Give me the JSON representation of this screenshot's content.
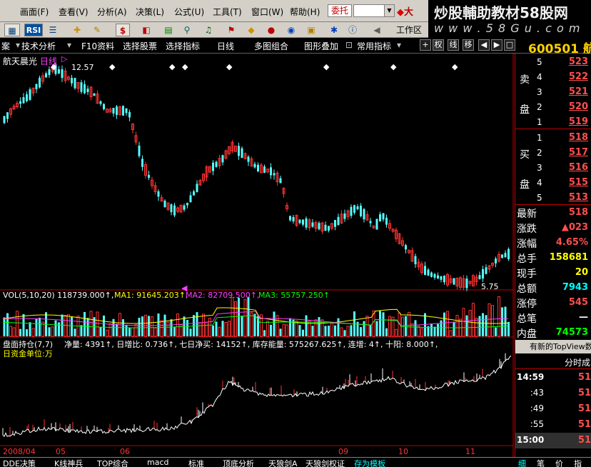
{
  "menu": {
    "items": [
      "画面(F)",
      "查看(V)",
      "分析(A)",
      "决策(L)",
      "公式(U)",
      "工具(T)",
      "窗口(W)",
      "帮助(H)"
    ],
    "weituo": "委托",
    "brand_short": "大"
  },
  "toolbar": {
    "rsi": "RSI",
    "workspace": "工作区"
  },
  "banner": {
    "title": "炒股輔助教材58股网",
    "url": "w w w . 5 8 G u . c o m"
  },
  "nav": {
    "items": [
      "案",
      "技术分析",
      "F10资料",
      "选择股票",
      "选择指标",
      "日线",
      "多图组合",
      "图形叠加",
      "常用指标"
    ],
    "buttons": [
      "权",
      "线",
      "移"
    ],
    "code": "600501 航"
  },
  "chart": {
    "stock_title": "航天晨光",
    "period": "日线",
    "high_label": "12.57",
    "low_label": "5.75",
    "vol_line": {
      "vol": "VOL(5,10,20) 118739.000↑,",
      "ma1": "MA1: 91645.203↑,",
      "ma2": "MA2: 82709.500↑,",
      "ma3": "MA3: 55757.250↑"
    },
    "pos_line": {
      "name": "盘面持仓(7,7)",
      "text": "净量: 4391↑, 日增比: 0.736↑, 七日净买: 14152↑, 库存能量: 575267.625↑, 连增: 4↑, 十阳: 8.000↑,"
    },
    "unit_line": "日资金单位:万",
    "x_labels": {
      "first": "2008/04",
      "m05": "05",
      "m06": "06",
      "m09": "09",
      "m10": "10",
      "m11": "11"
    }
  },
  "orderbook": {
    "sell_label": [
      "卖",
      "盘"
    ],
    "buy_label": [
      "买",
      "盘"
    ],
    "sell": [
      {
        "n": "5",
        "p": "523"
      },
      {
        "n": "4",
        "p": "522"
      },
      {
        "n": "3",
        "p": "521"
      },
      {
        "n": "2",
        "p": "520"
      },
      {
        "n": "1",
        "p": "519"
      }
    ],
    "buy": [
      {
        "n": "1",
        "p": "518"
      },
      {
        "n": "2",
        "p": "517"
      },
      {
        "n": "3",
        "p": "516"
      },
      {
        "n": "4",
        "p": "515"
      },
      {
        "n": "5",
        "p": "513"
      }
    ]
  },
  "stats": [
    {
      "label": "最新",
      "value": "518",
      "color": "#ff5050"
    },
    {
      "label": "涨跌",
      "value": "▲023",
      "color": "#ff5050"
    },
    {
      "label": "涨幅",
      "value": "4.65%",
      "color": "#ff5050"
    },
    {
      "label": "总手",
      "value": "158681",
      "color": "#ffff00"
    },
    {
      "label": "现手",
      "value": "20",
      "color": "#ffff00"
    },
    {
      "label": "总额",
      "value": "7943",
      "color": "#00ffff"
    },
    {
      "label": "涨停",
      "value": "545",
      "color": "#ff5050"
    },
    {
      "label": "总笔",
      "value": "—",
      "color": "#ffffff"
    },
    {
      "label": "内盘",
      "value": "74573",
      "color": "#00ff00"
    }
  ],
  "topview": "有新的TopView数",
  "ticks": {
    "header": "分时成",
    "rows": [
      {
        "t": "14:59",
        "v": "51"
      },
      {
        "t": ":43",
        "v": "51"
      },
      {
        "t": ":49",
        "v": "51"
      },
      {
        "t": ":55",
        "v": "51"
      },
      {
        "t": "15:00",
        "v": "51"
      }
    ]
  },
  "right_tabs": [
    "细",
    "笔",
    "价",
    "指"
  ],
  "bottom_tabs": [
    "DDE决策",
    "K线神兵",
    "TOP综合",
    "macd",
    "标准",
    "顶底分析",
    "天狼剑A",
    "天狼剑权证",
    "存为模板"
  ],
  "colors": {
    "up": "#ff3333",
    "down": "#54ffff",
    "yellow": "#ffff00",
    "magenta": "#ff40ff",
    "green": "#00ff00",
    "grid_red": "#c00000"
  }
}
